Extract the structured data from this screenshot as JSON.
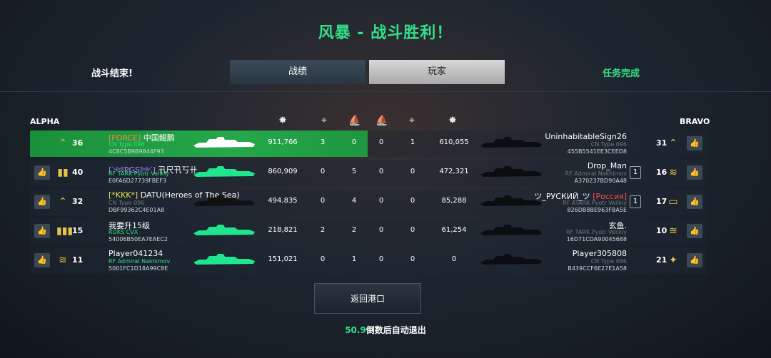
{
  "header": {
    "title": "风暴 - 战斗胜利！",
    "status_left": "战斗结束!",
    "status_right": "任务完成"
  },
  "tabs": [
    "战绩",
    "玩家"
  ],
  "teams": {
    "left": "ALPHA",
    "right": "BRAVO"
  },
  "alpha": [
    {
      "tag": "[FORCE]",
      "name": "中国鲲鹏",
      "ship": "CN Type 096",
      "id": "4C8C5B9B9844F93",
      "level": "36",
      "score": "911,766",
      "kills": "3",
      "assists": "0",
      "highlight": true,
      "ship_dim": false
    },
    {
      "tag": "[༺PGS༻]",
      "name": "卂尺卂丂卄",
      "ship": "RF TARK Pyotr Velikiy",
      "id": "E0FA6D27739FBEF3",
      "level": "40",
      "score": "860,909",
      "kills": "0",
      "assists": "5",
      "highlight": false,
      "ship_dim": false
    },
    {
      "tag": "[*KKK*]",
      "name": "DATU(Heroes of The Sea)",
      "ship": "CN Type 096",
      "id": "DBF99362C4E01A8",
      "level": "32",
      "score": "494,835",
      "kills": "0",
      "assists": "4",
      "highlight": false,
      "ship_dim": true
    },
    {
      "tag": "",
      "name": "我要升15级",
      "ship": "ROKS CVX",
      "id": "54006B50EA7EAEC2",
      "level": "15",
      "score": "218,821",
      "kills": "2",
      "assists": "2",
      "highlight": false,
      "ship_dim": false
    },
    {
      "tag": "",
      "name": "Player041234",
      "ship": "RF Admiral Nakhimov",
      "id": "5001FC1D18A99C8E",
      "level": "11",
      "score": "151,021",
      "kills": "0",
      "assists": "1",
      "highlight": false,
      "ship_dim": false
    }
  ],
  "bravo": [
    {
      "name": "UninhabitableSign26",
      "suffix": "",
      "ship": "CN Type 096",
      "id": "455B5541EE3CEED8",
      "level": "31",
      "score": "610,055",
      "kills": "0",
      "assists": "1",
      "box": ""
    },
    {
      "name": "Drop_Man",
      "suffix": "",
      "ship": "RF Admiral Nakhimov",
      "id": "A370237BD90A48",
      "level": "16",
      "score": "472,321",
      "kills": "0",
      "assists": "0",
      "box": "1"
    },
    {
      "name": "ツ_РУСКИЙ_ツ",
      "suffix": "[Россия]",
      "ship": "RF ATARK Pyotr Velikiy",
      "id": "826DB8BE963FBA5E",
      "level": "17",
      "score": "85,288",
      "kills": "0",
      "assists": "0",
      "box": "1"
    },
    {
      "name": "玄鱼.",
      "suffix": "",
      "ship": "RF TARK Pyotr Velikiy",
      "id": "16D71CDA90045688",
      "level": "10",
      "score": "61,254",
      "kills": "0",
      "assists": "0",
      "box": ""
    },
    {
      "name": "Player305808",
      "suffix": "",
      "ship": "CN Type 096",
      "id": "B439CCF6E27E1A58",
      "level": "21",
      "score": "0",
      "kills": "0",
      "assists": "0",
      "box": ""
    }
  ],
  "buttons": {
    "return": "返回港口"
  },
  "countdown": {
    "seconds": "50.9",
    "text": "倒数后自动退出"
  }
}
